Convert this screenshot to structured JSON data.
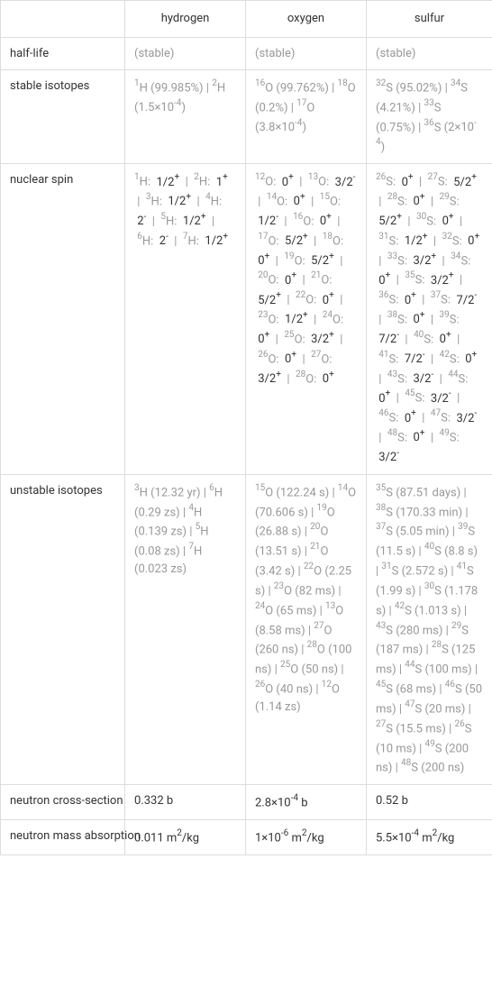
{
  "header": {
    "col0": "",
    "col1": "hydrogen",
    "col2": "oxygen",
    "col3": "sulfur"
  },
  "rows": {
    "half_life": {
      "label": "half-life",
      "hydrogen": "(stable)",
      "oxygen": "(stable)",
      "sulfur": "(stable)"
    },
    "stable_isotopes": {
      "label": "stable isotopes",
      "hydrogen_html": "<span class='sup'>1</span>H <span style='color:#999'>(99.985%) | </span><span class='sup'>2</span>H<span style='color:#999'> (1.5×10<span class='sup'>-4</span>)</span>",
      "oxygen_html": "<span class='sup'>16</span>O <span style='color:#999'>(99.762%) | </span><span class='sup'>18</span>O<span style='color:#999'> (0.2%) | </span><span class='sup'>17</span>O<span style='color:#999'> (3.8×10<span class='sup'>-4</span>)</span>",
      "sulfur_html": "<span class='sup'>32</span>S <span style='color:#999'>(95.02%) | </span><span class='sup'>34</span>S<span style='color:#999'> (4.21%) | </span><span class='sup'>33</span>S<span style='color:#999'> (0.75%) | </span><span class='sup'>36</span>S<span style='color:#999'> (2×10<span class='sup'>-4</span>)</span>"
    },
    "nuclear_spin": {
      "label": "nuclear spin",
      "hydrogen_html": "<span class='sup'>1</span>H: &nbsp;<span class='val-dark'>1/2<span class='sup'>+</span></span> &nbsp;| &nbsp;<span class='sup'>2</span>H: &nbsp;<span class='val-dark'>1<span class='sup'>+</span></span> &nbsp;| &nbsp;<span class='sup'>3</span>H: &nbsp;<span class='val-dark'>1/2<span class='sup'>+</span></span> &nbsp;| &nbsp;<span class='sup'>4</span>H: &nbsp;<span class='val-dark'>2<span class='sup'>-</span></span> &nbsp;| &nbsp;<span class='sup'>5</span>H: &nbsp;<span class='val-dark'>1/2<span class='sup'>+</span></span> &nbsp;| &nbsp;<span class='sup'>6</span>H: &nbsp;<span class='val-dark'>2<span class='sup'>-</span></span> &nbsp;| &nbsp;<span class='sup'>7</span>H: &nbsp;<span class='val-dark'>1/2<span class='sup'>+</span></span>",
      "oxygen_html": "<span class='sup'>12</span>O: &nbsp;<span class='val-dark'>0<span class='sup'>+</span></span> &nbsp;| &nbsp;<span class='sup'>13</span>O: &nbsp;<span class='val-dark'>3/2<span class='sup'>-</span></span> &nbsp;| &nbsp;<span class='sup'>14</span>O: &nbsp;<span class='val-dark'>0<span class='sup'>+</span></span> &nbsp;| &nbsp;<span class='sup'>15</span>O: &nbsp;<span class='val-dark'>1/2<span class='sup'>-</span></span> &nbsp;| &nbsp;<span class='sup'>16</span>O: &nbsp;<span class='val-dark'>0<span class='sup'>+</span></span> &nbsp;| &nbsp;<span class='sup'>17</span>O: &nbsp;<span class='val-dark'>5/2<span class='sup'>+</span></span> &nbsp;| &nbsp;<span class='sup'>18</span>O: &nbsp;<span class='val-dark'>0<span class='sup'>+</span></span> &nbsp;| &nbsp;<span class='sup'>19</span>O: &nbsp;<span class='val-dark'>5/2<span class='sup'>+</span></span> &nbsp;| &nbsp;<span class='sup'>20</span>O: &nbsp;<span class='val-dark'>0<span class='sup'>+</span></span> &nbsp;| &nbsp;<span class='sup'>21</span>O: &nbsp;<span class='val-dark'>5/2<span class='sup'>+</span></span> &nbsp;| &nbsp;<span class='sup'>22</span>O: &nbsp;<span class='val-dark'>0<span class='sup'>+</span></span> &nbsp;| &nbsp;<span class='sup'>23</span>O: &nbsp;<span class='val-dark'>1/2<span class='sup'>+</span></span> &nbsp;| &nbsp;<span class='sup'>24</span>O: &nbsp;<span class='val-dark'>0<span class='sup'>+</span></span> &nbsp;| &nbsp;<span class='sup'>25</span>O: &nbsp;<span class='val-dark'>3/2<span class='sup'>+</span></span> &nbsp;| &nbsp;<span class='sup'>26</span>O: &nbsp;<span class='val-dark'>0<span class='sup'>+</span></span> &nbsp;| &nbsp;<span class='sup'>27</span>O: &nbsp;<span class='val-dark'>3/2<span class='sup'>+</span></span> &nbsp;| &nbsp;<span class='sup'>28</span>O: &nbsp;<span class='val-dark'>0<span class='sup'>+</span></span>",
      "sulfur_html": "<span class='sup'>26</span>S: &nbsp;<span class='val-dark'>0<span class='sup'>+</span></span> &nbsp;| &nbsp;<span class='sup'>27</span>S: &nbsp;<span class='val-dark'>5/2<span class='sup'>+</span></span> &nbsp;| &nbsp;<span class='sup'>28</span>S: &nbsp;<span class='val-dark'>0<span class='sup'>+</span></span> &nbsp;| &nbsp;<span class='sup'>29</span>S: &nbsp;<span class='val-dark'>5/2<span class='sup'>+</span></span> &nbsp;| &nbsp;<span class='sup'>30</span>S: &nbsp;<span class='val-dark'>0<span class='sup'>+</span></span> &nbsp;| &nbsp;<span class='sup'>31</span>S: &nbsp;<span class='val-dark'>1/2<span class='sup'>+</span></span> &nbsp;| &nbsp;<span class='sup'>32</span>S: &nbsp;<span class='val-dark'>0<span class='sup'>+</span></span> &nbsp;| &nbsp;<span class='sup'>33</span>S: &nbsp;<span class='val-dark'>3/2<span class='sup'>+</span></span> &nbsp;| &nbsp;<span class='sup'>34</span>S: &nbsp;<span class='val-dark'>0<span class='sup'>+</span></span> &nbsp;| &nbsp;<span class='sup'>35</span>S: &nbsp;<span class='val-dark'>3/2<span class='sup'>+</span></span> &nbsp;| &nbsp;<span class='sup'>36</span>S: &nbsp;<span class='val-dark'>0<span class='sup'>+</span></span> &nbsp;| &nbsp;<span class='sup'>37</span>S: &nbsp;<span class='val-dark'>7/2<span class='sup'>-</span></span> &nbsp;| &nbsp;<span class='sup'>38</span>S: &nbsp;<span class='val-dark'>0<span class='sup'>+</span></span> &nbsp;| &nbsp;<span class='sup'>39</span>S: &nbsp;<span class='val-dark'>7/2<span class='sup'>-</span></span> &nbsp;| &nbsp;<span class='sup'>40</span>S: &nbsp;<span class='val-dark'>0<span class='sup'>+</span></span> &nbsp;| &nbsp;<span class='sup'>41</span>S: &nbsp;<span class='val-dark'>7/2<span class='sup'>-</span></span> &nbsp;| &nbsp;<span class='sup'>42</span>S: &nbsp;<span class='val-dark'>0<span class='sup'>+</span></span> &nbsp;| &nbsp;<span class='sup'>43</span>S: &nbsp;<span class='val-dark'>3/2<span class='sup'>-</span></span> &nbsp;| &nbsp;<span class='sup'>44</span>S: &nbsp;<span class='val-dark'>0<span class='sup'>+</span></span> &nbsp;| &nbsp;<span class='sup'>45</span>S: &nbsp;<span class='val-dark'>3/2<span class='sup'>-</span></span> &nbsp;| &nbsp;<span class='sup'>46</span>S: &nbsp;<span class='val-dark'>0<span class='sup'>+</span></span> &nbsp;| &nbsp;<span class='sup'>47</span>S: &nbsp;<span class='val-dark'>3/2<span class='sup'>-</span></span> &nbsp;| &nbsp;<span class='sup'>48</span>S: &nbsp;<span class='val-dark'>0<span class='sup'>+</span></span> &nbsp;| &nbsp;<span class='sup'>49</span>S: &nbsp;<span class='val-dark'>3/2<span class='sup'>-</span></span>"
    },
    "unstable_isotopes": {
      "label": "unstable isotopes",
      "hydrogen_html": "<span class='sup'>3</span>H <span style='color:#999'>(12.32 yr) | </span><span class='sup'>6</span>H<span style='color:#999'> (0.29 zs) | </span><span class='sup'>4</span>H<span style='color:#999'> (0.139 zs) | </span><span class='sup'>5</span>H<span style='color:#999'> (0.08 zs) | </span><span class='sup'>7</span>H<span style='color:#999'> (0.023 zs)</span>",
      "oxygen_html": "<span class='sup'>15</span>O <span style='color:#999'>(122.24 s) | </span><span class='sup'>14</span>O<span style='color:#999'> (70.606 s) | </span><span class='sup'>19</span>O<span style='color:#999'> (26.88 s) | </span><span class='sup'>20</span>O<span style='color:#999'> (13.51 s) | </span><span class='sup'>21</span>O<span style='color:#999'> (3.42 s) | </span><span class='sup'>22</span>O<span style='color:#999'> (2.25 s) | </span><span class='sup'>23</span>O<span style='color:#999'> (82 ms) | </span><span class='sup'>24</span>O<span style='color:#999'> (65 ms) | </span><span class='sup'>13</span>O<span style='color:#999'> (8.58 ms) | </span><span class='sup'>27</span>O<span style='color:#999'> (260 ns) | </span><span class='sup'>28</span>O<span style='color:#999'> (100 ns) | </span><span class='sup'>25</span>O<span style='color:#999'> (50 ns) | </span><span class='sup'>26</span>O<span style='color:#999'> (40 ns) | </span><span class='sup'>12</span>O<span style='color:#999'> (1.14 zs)</span>",
      "sulfur_html": "<span class='sup'>35</span>S <span style='color:#999'>(87.51 days) | </span><span class='sup'>38</span>S<span style='color:#999'> (170.33 min) | </span><span class='sup'>37</span>S<span style='color:#999'> (5.05 min) | </span><span class='sup'>39</span>S<span style='color:#999'> (11.5 s) | </span><span class='sup'>40</span>S<span style='color:#999'> (8.8 s) | </span><span class='sup'>31</span>S<span style='color:#999'> (2.572 s) | </span><span class='sup'>41</span>S<span style='color:#999'> (1.99 s) | </span><span class='sup'>30</span>S<span style='color:#999'> (1.178 s) | </span><span class='sup'>42</span>S<span style='color:#999'> (1.013 s) | </span><span class='sup'>43</span>S<span style='color:#999'> (280 ms) | </span><span class='sup'>29</span>S<span style='color:#999'> (187 ms) | </span><span class='sup'>28</span>S<span style='color:#999'> (125 ms) | </span><span class='sup'>44</span>S<span style='color:#999'> (100 ms) | </span><span class='sup'>45</span>S<span style='color:#999'> (68 ms) | </span><span class='sup'>46</span>S<span style='color:#999'> (50 ms) | </span><span class='sup'>47</span>S<span style='color:#999'> (20 ms) | </span><span class='sup'>27</span>S<span style='color:#999'> (15.5 ms) | </span><span class='sup'>26</span>S<span style='color:#999'> (10 ms) | </span><span class='sup'>49</span>S<span style='color:#999'> (200 ns) | </span><span class='sup'>48</span>S<span style='color:#999'> (200 ns)</span>"
    },
    "neutron_cross_section": {
      "label": "neutron cross-section",
      "hydrogen": "0.332 b",
      "oxygen_html": "2.8×10<span class='sup'>-4</span> b",
      "sulfur": "0.52 b"
    },
    "neutron_mass_absorption": {
      "label": "neutron mass absorption",
      "hydrogen_html": "0.011 m<span class='sup'>2</span>/kg",
      "oxygen_html": "1×10<span class='sup'>-6</span> m<span class='sup'>2</span>/kg",
      "sulfur_html": "5.5×10<span class='sup'>-4</span> m<span class='sup'>2</span>/kg"
    }
  }
}
